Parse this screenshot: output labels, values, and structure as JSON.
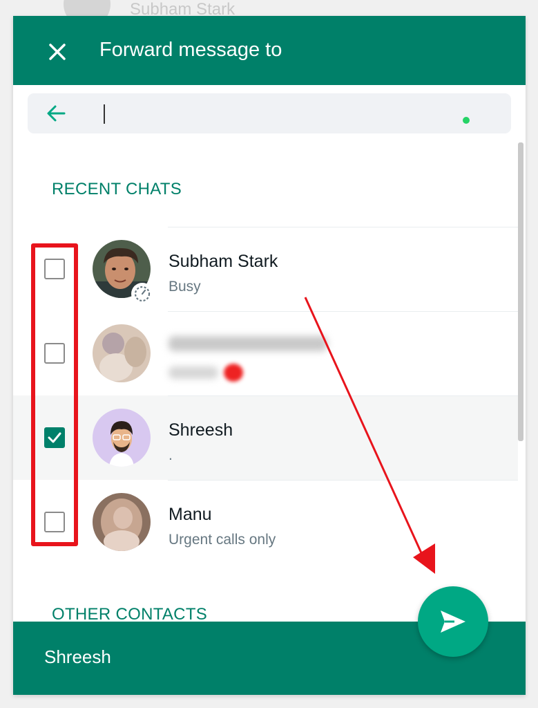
{
  "background": {
    "contact_name": "Subham Stark"
  },
  "dialog": {
    "title": "Forward message to",
    "close_icon": "close-icon",
    "back_icon": "arrow-left-icon",
    "search": {
      "value": "",
      "placeholder": ""
    }
  },
  "sections": {
    "recent": "RECENT CHATS",
    "other": "OTHER CONTACTS"
  },
  "contacts": [
    {
      "name": "Subham Stark",
      "status": "Busy",
      "checked": false,
      "has_status_badge": true
    },
    {
      "name": "",
      "status": "",
      "checked": false,
      "blurred": true
    },
    {
      "name": "Shreesh",
      "status": ".",
      "checked": true
    },
    {
      "name": "Manu",
      "status": "Urgent calls only",
      "checked": false
    }
  ],
  "footer": {
    "selected_names": "Shreesh",
    "send_icon": "send-icon"
  },
  "colors": {
    "accent": "#008069",
    "send_button": "#00a884",
    "annotation": "#e8141c"
  }
}
